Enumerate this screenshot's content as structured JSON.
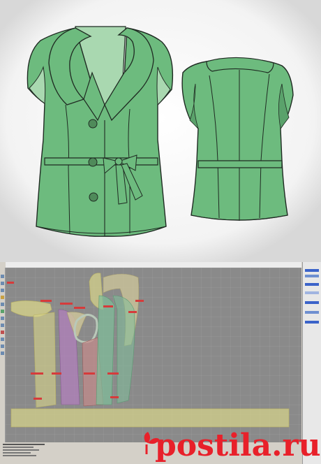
{
  "illustration": {
    "garment": "sleeveless-vest-with-shawl-collar-and-belt",
    "fill_color": "#6dbb7e",
    "shade_color": "#5aa26b",
    "lining_color": "#a9d8b0",
    "outline_color": "#1f2a22",
    "button_color": "#4f8a5a",
    "shadow_color": "#c9c9c9"
  },
  "cad": {
    "background": "#8a8a8a",
    "grid_color": "#a3a3a3",
    "panel_colors": [
      "#d9d58a",
      "#b37fbf",
      "#c58a8a",
      "#7fbf9a",
      "#cfc79a"
    ],
    "label_color": "#d63b3b"
  },
  "watermark": {
    "brand": "postila.ru",
    "brand_color": "#e8202a"
  }
}
